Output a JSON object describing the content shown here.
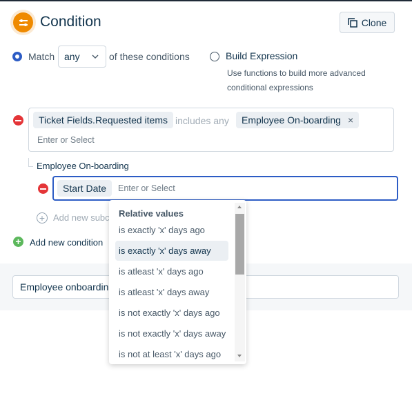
{
  "header": {
    "title": "Condition",
    "icon": "sliders-icon",
    "clone_label": "Clone"
  },
  "match": {
    "label": "Match",
    "selected": "any",
    "suffix": "of these conditions"
  },
  "build_expression": {
    "label": "Build Expression",
    "help_line1": "Use functions to build more advanced",
    "help_line2": "conditional expressions"
  },
  "condition": {
    "field": "Ticket Fields.Requested items",
    "operator": "includes any",
    "value": "Employee On-boarding",
    "placeholder": "Enter or Select"
  },
  "subcondition": {
    "group_label": "Employee On-boarding",
    "field": "Start Date",
    "placeholder": "Enter or Select",
    "add_label": "Add new subcondition"
  },
  "add_condition_label": "Add new condition",
  "name_input": {
    "value": "Employee onboarding"
  },
  "dropdown": {
    "header": "Relative values",
    "items": [
      "is exactly 'x' days ago",
      "is exactly 'x' days away",
      "is atleast 'x' days ago",
      "is atleast 'x' days away",
      "is not exactly 'x' days ago",
      "is not exactly 'x' days away",
      "is not at least 'x' days ago"
    ],
    "highlighted_index": 1
  },
  "colors": {
    "accent": "#2c5cc5",
    "icon_orange": "#ef8a00",
    "remove_red": "#e43538",
    "add_green": "#5cb85c"
  }
}
